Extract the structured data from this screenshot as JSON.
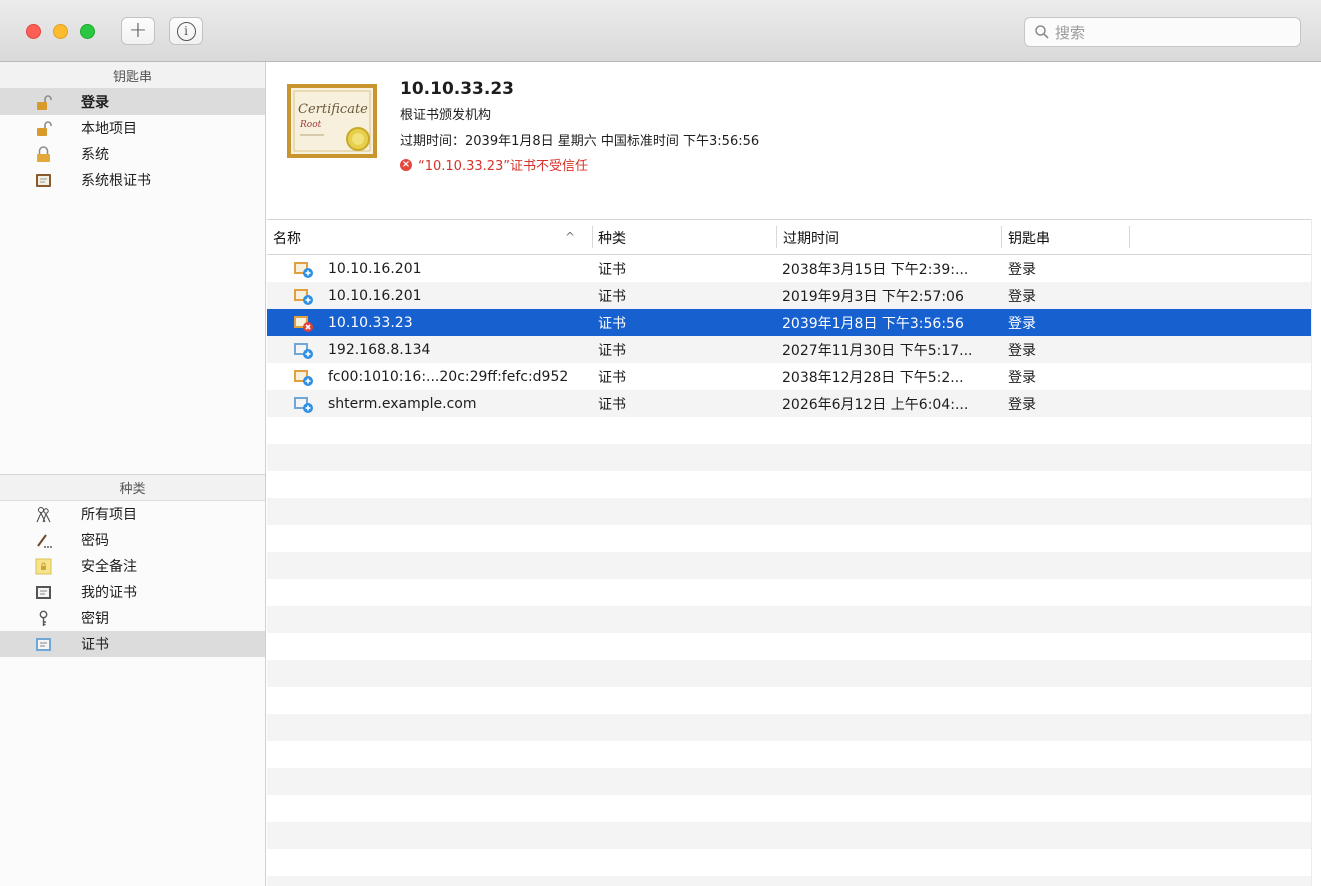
{
  "toolbar": {
    "add_label": "+",
    "info_label": "i",
    "search_placeholder": "搜索"
  },
  "keychains": {
    "header": "钥匙串",
    "items": [
      {
        "label": "登录",
        "icon": "unlocked-padlock-icon",
        "selected": true
      },
      {
        "label": "本地项目",
        "icon": "unlocked-padlock-icon"
      },
      {
        "label": "系统",
        "icon": "locked-padlock-icon"
      },
      {
        "label": "系统根证书",
        "icon": "root-cert-folder-icon"
      }
    ]
  },
  "categories": {
    "header": "种类",
    "items": [
      {
        "label": "所有项目",
        "icon": "people-icon"
      },
      {
        "label": "密码",
        "icon": "pen-icon"
      },
      {
        "label": "安全备注",
        "icon": "secure-note-icon"
      },
      {
        "label": "我的证书",
        "icon": "my-cert-icon"
      },
      {
        "label": "密钥",
        "icon": "key-icon"
      },
      {
        "label": "证书",
        "icon": "certificate-icon",
        "selected": true
      }
    ]
  },
  "detail": {
    "title": "10.10.33.23",
    "issuer": "根证书颁发机构",
    "expiry": "过期时间：2039年1月8日 星期六 中国标准时间 下午3:56:56",
    "warning": "“10.10.33.23”证书不受信任",
    "cert_image_text_1": "Certificate",
    "cert_image_text_2": "Root"
  },
  "table": {
    "columns": {
      "name": "名称",
      "kind": "种类",
      "expires": "过期时间",
      "keychain": "钥匙串"
    },
    "sort_indicator": "^",
    "rows": [
      {
        "name": "10.10.16.201",
        "kind": "证书",
        "expires": "2038年3月15日 下午2:39:...",
        "keychain": "登录",
        "icon": "cert-trusted-icon"
      },
      {
        "name": "10.10.16.201",
        "kind": "证书",
        "expires": "2019年9月3日 下午2:57:06",
        "keychain": "登录",
        "icon": "cert-trusted-icon"
      },
      {
        "name": "10.10.33.23",
        "kind": "证书",
        "expires": "2039年1月8日 下午3:56:56",
        "keychain": "登录",
        "icon": "cert-untrusted-icon",
        "selected": true
      },
      {
        "name": "192.168.8.134",
        "kind": "证书",
        "expires": "2027年11月30日 下午5:17...",
        "keychain": "登录",
        "icon": "cert-trusted-icon"
      },
      {
        "name": "fc00:1010:16:...20c:29ff:fefc:d952",
        "kind": "证书",
        "expires": "2038年12月28日 下午5:2...",
        "keychain": "登录",
        "icon": "cert-trusted-icon"
      },
      {
        "name": "shterm.example.com",
        "kind": "证书",
        "expires": "2026年6月12日 上午6:04:...",
        "keychain": "登录",
        "icon": "cert-trusted-icon"
      }
    ]
  },
  "colors": {
    "selection": "#1760d0",
    "warning": "#d6312a"
  }
}
